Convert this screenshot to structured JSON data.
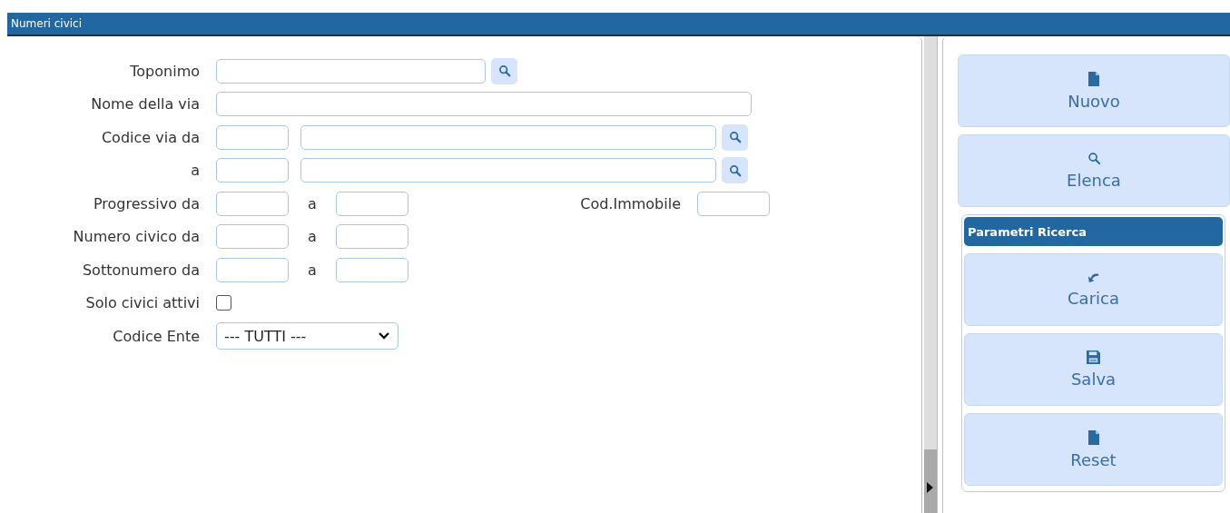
{
  "window": {
    "title": "Numeri civici"
  },
  "form": [
    {
      "kind": "search",
      "label": "Toponimo"
    },
    {
      "kind": "text",
      "label": "Nome della via"
    },
    {
      "kind": "code_range",
      "label": "Codice via da"
    },
    {
      "kind": "code_range",
      "label": "a"
    },
    {
      "kind": "range",
      "label": "Progressivo da",
      "separator": "a",
      "extra_label": "Cod.Immobile"
    },
    {
      "kind": "range",
      "label": "Numero civico da",
      "separator": "a"
    },
    {
      "kind": "range",
      "label": "Sottonumero da",
      "separator": "a"
    },
    {
      "kind": "checkbox",
      "label": "Solo civici attivi",
      "checked": false
    },
    {
      "kind": "select",
      "label": "Codice Ente",
      "value": "--- TUTTI ---"
    }
  ],
  "actions": [
    {
      "kind": "new",
      "label": "Nuovo"
    },
    {
      "kind": "list",
      "label": "Elenca"
    }
  ],
  "search_params": {
    "title": "Parametri Ricerca",
    "actions": [
      {
        "kind": "load",
        "label": "Carica"
      },
      {
        "kind": "save",
        "label": "Salva"
      },
      {
        "kind": "reset",
        "label": "Reset"
      }
    ]
  }
}
